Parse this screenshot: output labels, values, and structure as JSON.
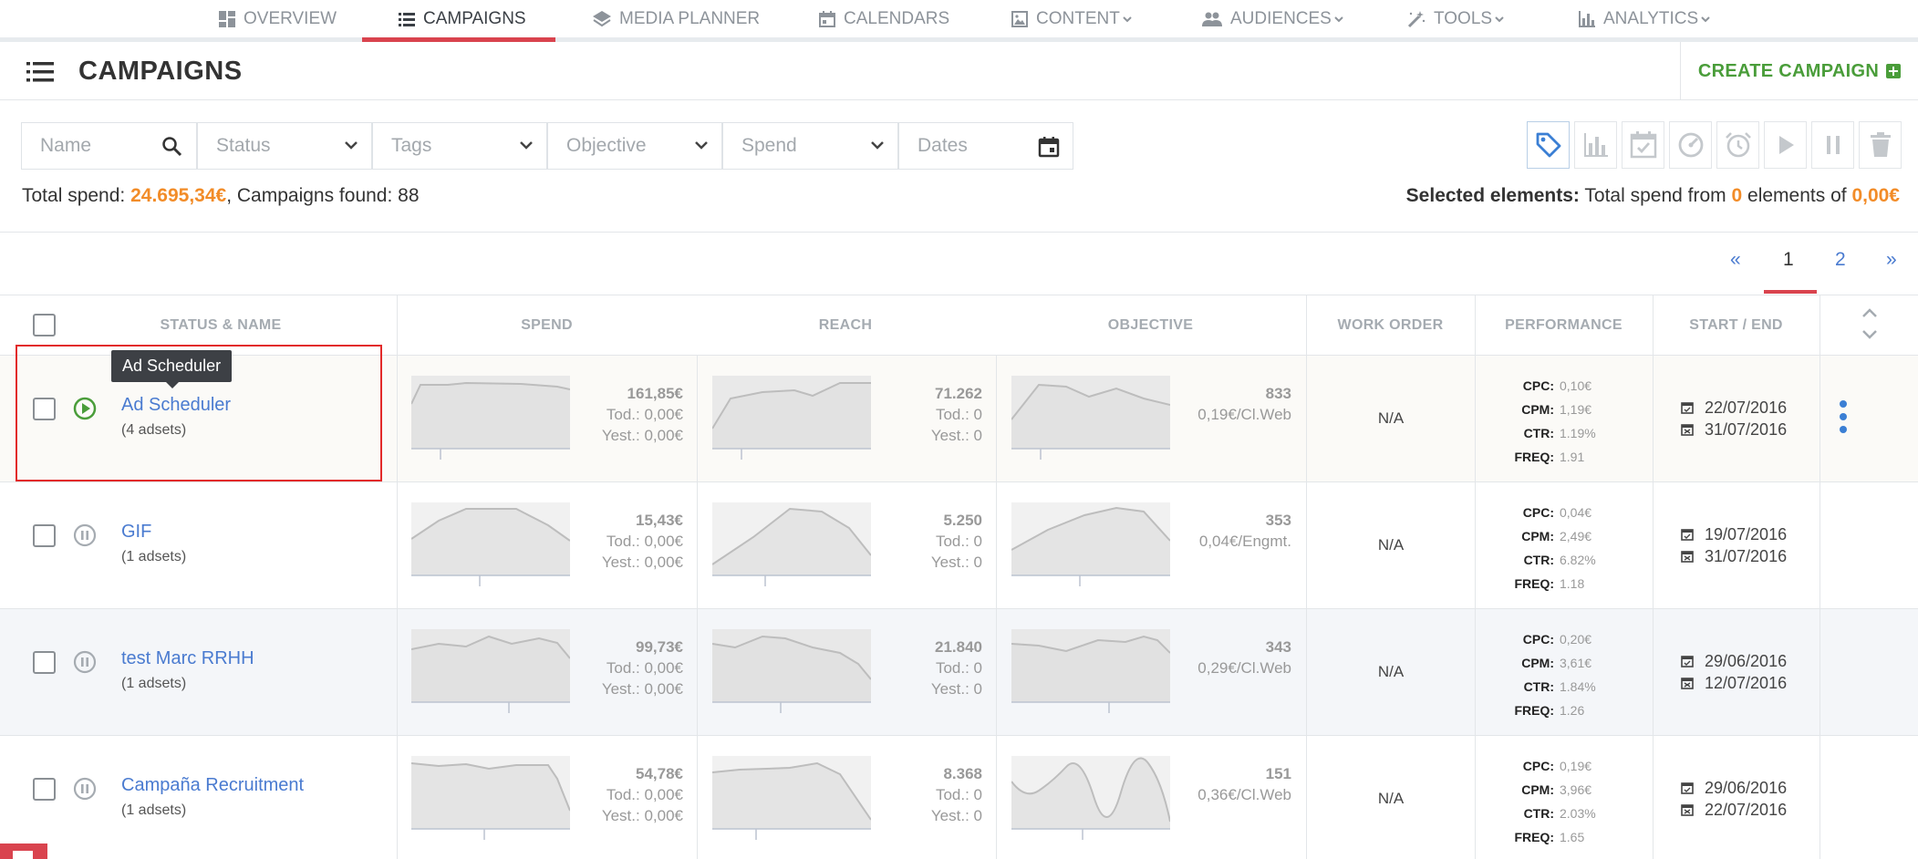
{
  "nav": {
    "items": [
      {
        "label": "OVERVIEW",
        "icon": "dashboard-icon"
      },
      {
        "label": "CAMPAIGNS",
        "icon": "list-icon",
        "active": true
      },
      {
        "label": "MEDIA PLANNER",
        "icon": "layers-icon"
      },
      {
        "label": "CALENDARS",
        "icon": "calendar-icon"
      },
      {
        "label": "CONTENT",
        "icon": "image-icon"
      },
      {
        "label": "AUDIENCES",
        "icon": "people-icon"
      },
      {
        "label": "TOOLS",
        "icon": "magic-wand-icon"
      },
      {
        "label": "ANALYTICS",
        "icon": "bar-chart-icon"
      }
    ]
  },
  "header": {
    "title": "CAMPAIGNS",
    "create_label": "CREATE CAMPAIGN"
  },
  "filters": {
    "name": "Name",
    "status": "Status",
    "tags": "Tags",
    "objective": "Objective",
    "spend": "Spend",
    "dates": "Dates"
  },
  "totals": {
    "spend_label": "Total spend",
    "spend_value": "24.695,34€",
    "found_label": "Campaigns found",
    "found_value": "88"
  },
  "selected": {
    "label": "Selected elements:",
    "text1": "Total spend from",
    "count": "0",
    "text2": "elements of",
    "amount": "0,00€"
  },
  "pagination": {
    "prev": "«",
    "page1": "1",
    "page2": "2",
    "next": "»"
  },
  "columns": {
    "status_name": "STATUS & NAME",
    "spend": "SPEND",
    "reach": "REACH",
    "objective": "OBJECTIVE",
    "work_order": "WORK ORDER",
    "performance": "PERFORMANCE",
    "start_end": "START / END"
  },
  "perf_labels": {
    "cpc": "CPC:",
    "cpm": "CPM:",
    "ctr": "CTR:",
    "freq": "FREQ:"
  },
  "tooltip": "Ad Scheduler",
  "colors": {
    "accent": "#d9434e",
    "link": "#4a7bd0",
    "green": "#4a9d3a",
    "orange": "#f28c28"
  },
  "rows": [
    {
      "name": "Ad Scheduler",
      "adsets": "(4 adsets)",
      "status": "running",
      "spend": "161,85€",
      "spend_tod": "Tod.: 0,00€",
      "spend_yest": "Yest.: 0,00€",
      "reach": "71.262",
      "reach_tod": "Tod.: 0",
      "reach_yest": "Yest.: 0",
      "objective": "833",
      "objective_cost": "0,19€/Cl.Web",
      "work_order": "N/A",
      "cpc": "0,10€",
      "cpm": "1,19€",
      "ctr": "1.19%",
      "freq": "1.91",
      "start": "22/07/2016",
      "end": "31/07/2016"
    },
    {
      "name": "GIF",
      "adsets": "(1 adsets)",
      "status": "paused",
      "spend": "15,43€",
      "spend_tod": "Tod.: 0,00€",
      "spend_yest": "Yest.: 0,00€",
      "reach": "5.250",
      "reach_tod": "Tod.: 0",
      "reach_yest": "Yest.: 0",
      "objective": "353",
      "objective_cost": "0,04€/Engmt.",
      "work_order": "N/A",
      "cpc": "0,04€",
      "cpm": "2,49€",
      "ctr": "6.82%",
      "freq": "1.18",
      "start": "19/07/2016",
      "end": "31/07/2016"
    },
    {
      "name": "test Marc RRHH",
      "adsets": "(1 adsets)",
      "status": "paused",
      "spend": "99,73€",
      "spend_tod": "Tod.: 0,00€",
      "spend_yest": "Yest.: 0,00€",
      "reach": "21.840",
      "reach_tod": "Tod.: 0",
      "reach_yest": "Yest.: 0",
      "objective": "343",
      "objective_cost": "0,29€/Cl.Web",
      "work_order": "N/A",
      "cpc": "0,20€",
      "cpm": "3,61€",
      "ctr": "1.84%",
      "freq": "1.26",
      "start": "29/06/2016",
      "end": "12/07/2016"
    },
    {
      "name": "Campaña Recruitment",
      "adsets": "(1 adsets)",
      "status": "paused",
      "spend": "54,78€",
      "spend_tod": "Tod.: 0,00€",
      "spend_yest": "Yest.: 0,00€",
      "reach": "8.368",
      "reach_tod": "Tod.: 0",
      "reach_yest": "Yest.: 0",
      "objective": "151",
      "objective_cost": "0,36€/Cl.Web",
      "work_order": "N/A",
      "cpc": "0,19€",
      "cpm": "3,96€",
      "ctr": "2.03%",
      "freq": "1.65",
      "start": "29/06/2016",
      "end": "22/07/2016"
    }
  ]
}
